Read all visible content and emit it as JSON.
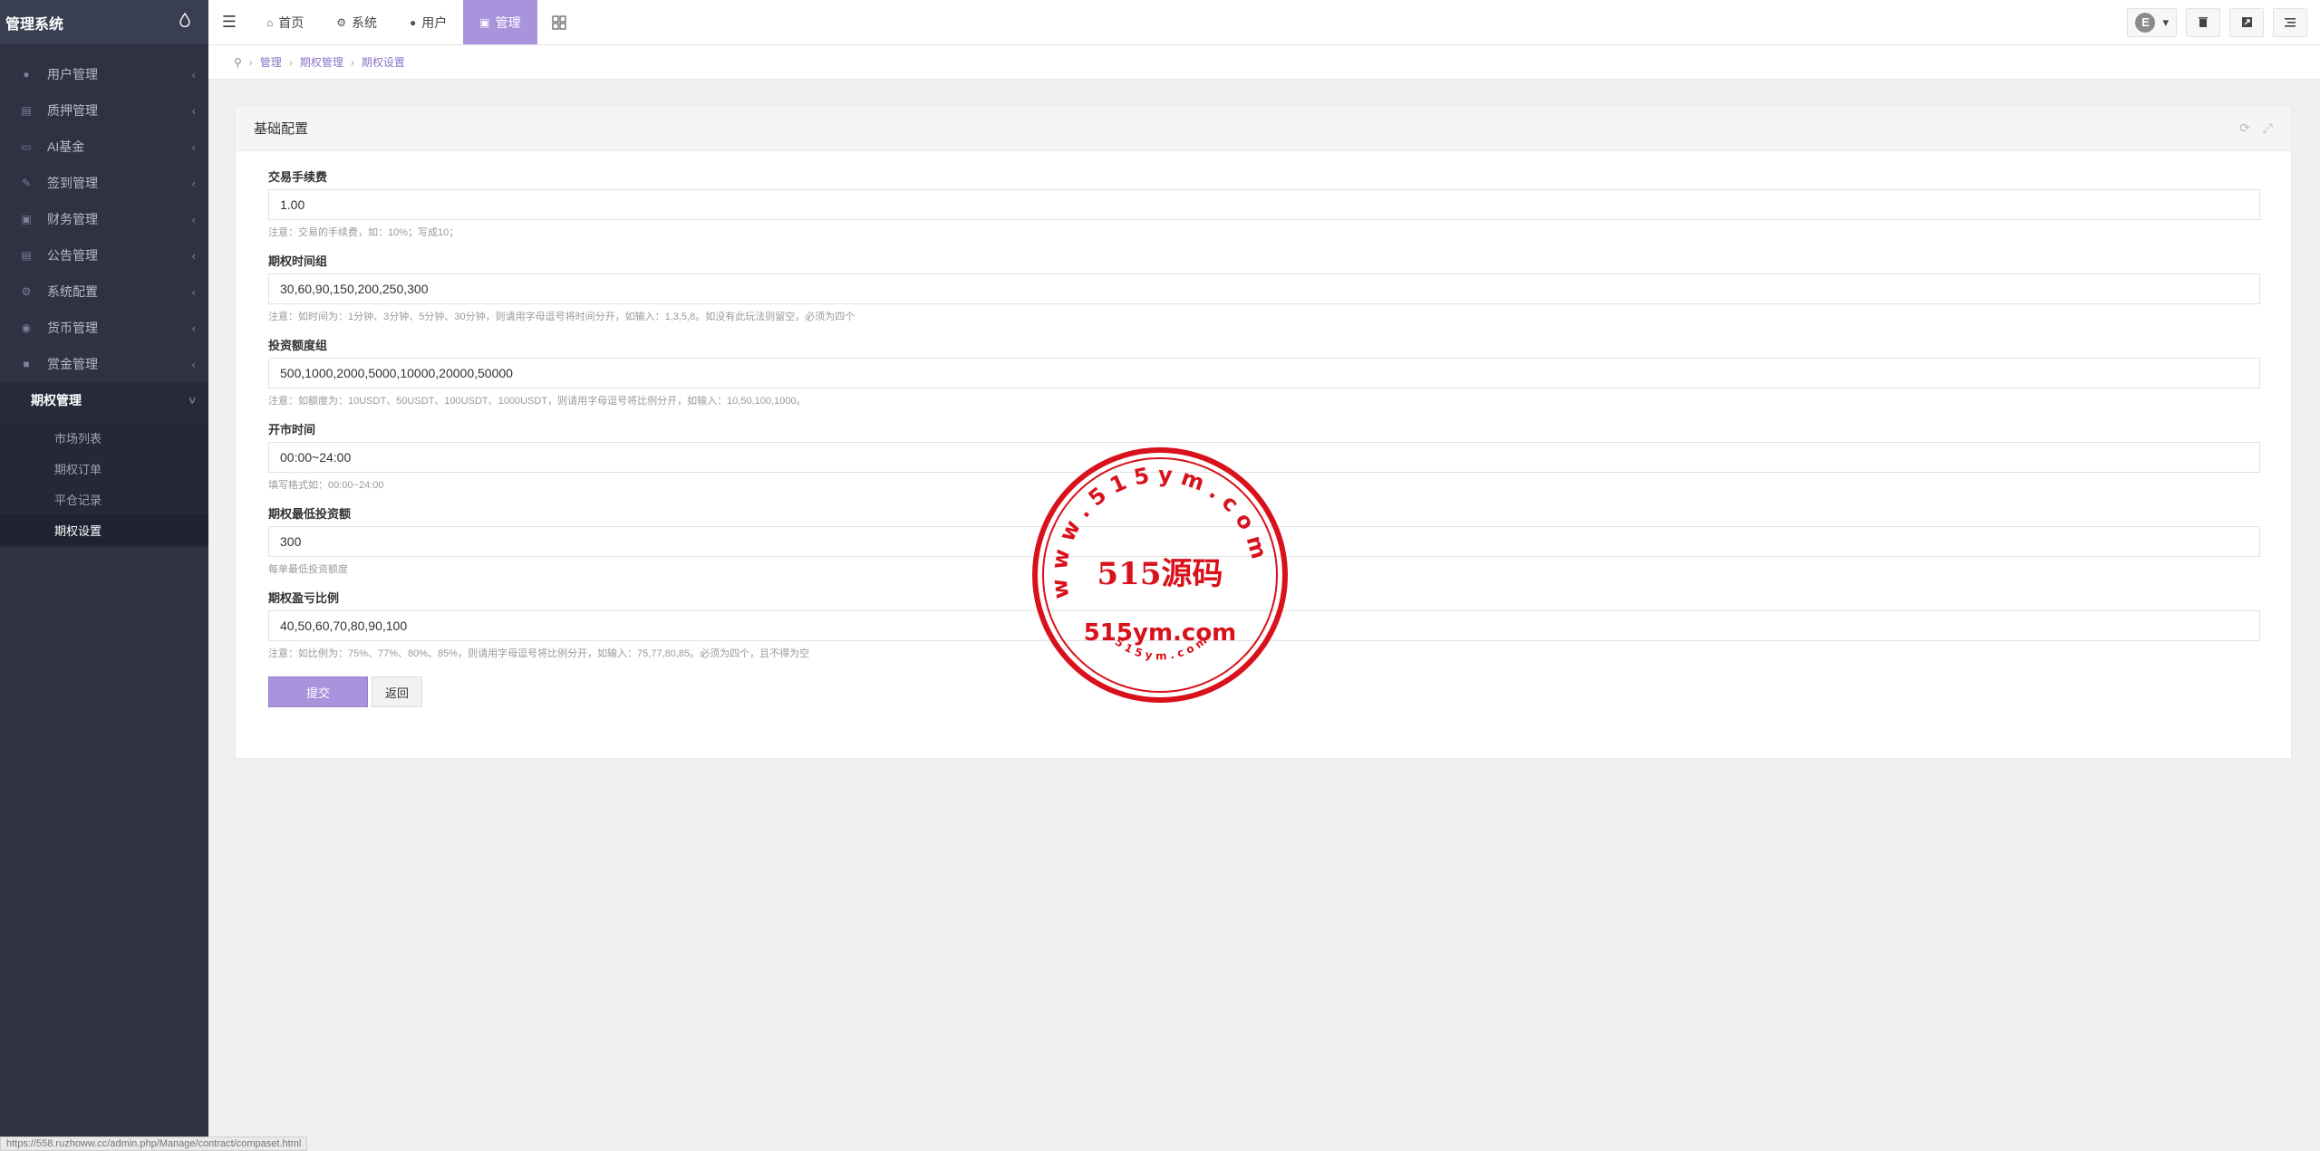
{
  "app": {
    "title": "管理系统"
  },
  "sidebar": {
    "items": [
      {
        "label": "用户管理",
        "icon": "user-icon"
      },
      {
        "label": "质押管理",
        "icon": "list-icon"
      },
      {
        "label": "AI基金",
        "icon": "monitor-icon"
      },
      {
        "label": "签到管理",
        "icon": "edit-icon"
      },
      {
        "label": "财务管理",
        "icon": "money-icon"
      },
      {
        "label": "公告管理",
        "icon": "list-icon"
      },
      {
        "label": "系统配置",
        "icon": "gears-icon"
      },
      {
        "label": "货币管理",
        "icon": "globe-icon"
      },
      {
        "label": "赏金管理",
        "icon": "lock-icon"
      }
    ],
    "open_section": {
      "label": "期权管理",
      "children": [
        {
          "label": "市场列表"
        },
        {
          "label": "期权订单"
        },
        {
          "label": "平仓记录"
        },
        {
          "label": "期权设置"
        }
      ],
      "active_child": "期权设置"
    }
  },
  "topbar": {
    "nav": [
      {
        "label": "首页",
        "icon": "home-icon"
      },
      {
        "label": "系统",
        "icon": "gear-icon"
      },
      {
        "label": "用户",
        "icon": "user-icon"
      },
      {
        "label": "管理",
        "icon": "briefcase-icon"
      }
    ],
    "active_nav": "管理",
    "avatar_letter": "E"
  },
  "breadcrumb": [
    "管理",
    "期权管理",
    "期权设置"
  ],
  "card": {
    "title": "基础配置",
    "fields": [
      {
        "label": "交易手续费",
        "value": "1.00",
        "help": "注意：交易的手续费，如：10%；写成10；"
      },
      {
        "label": "期权时间组",
        "value": "30,60,90,150,200,250,300",
        "help": "注意：如时间为：1分钟、3分钟、5分钟、30分钟，则请用字母逗号将时间分开，如输入：1,3,5,8。如没有此玩法则留空，必须为四个"
      },
      {
        "label": "投资额度组",
        "value": "500,1000,2000,5000,10000,20000,50000",
        "help": "注意：如额度为：10USDT、50USDT、100USDT、1000USDT，则请用字母逗号将比例分开，如输入：10,50,100,1000。"
      },
      {
        "label": "开市时间",
        "value": "00:00~24:00",
        "help": "填写格式如：00:00~24:00"
      },
      {
        "label": "期权最低投资额",
        "value": "300",
        "help": "每单最低投资额度"
      },
      {
        "label": "期权盈亏比例",
        "value": "40,50,60,70,80,90,100",
        "help": "注意：如比例为：75%、77%、80%、85%，则请用字母逗号将比例分开，如输入：75,77,80,85。必须为四个，且不得为空"
      }
    ],
    "submit_label": "提交",
    "back_label": "返回"
  },
  "watermark": {
    "center_text": "515源码",
    "domain_text": "515ym.com",
    "ring_text": "w w w . 5 1 5 y m . c o m",
    "bottom_text": "5 1 5 y m . c o m",
    "color": "#d9111b"
  },
  "status_url": "https://558.ruzhoww.cc/admin.php/Manage/contract/compaset.html",
  "colors": {
    "accent": "#a993dd",
    "sidebar_bg": "#2f3243"
  }
}
